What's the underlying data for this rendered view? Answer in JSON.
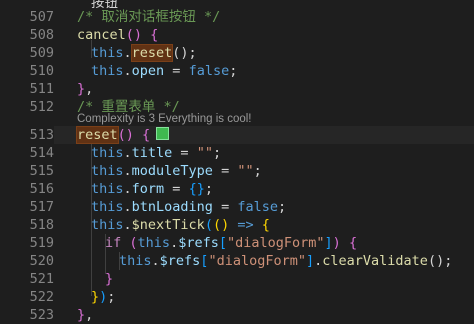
{
  "editor": {
    "codelens": "Complexity is 3 Everything is cool!",
    "lines": [
      {
        "num": "",
        "tokens": [
          {
            "t": "按钮",
            "c": "c-txt"
          }
        ]
      },
      {
        "num": "507",
        "tokens": [
          {
            "t": "/* 取消对话框按钮 */",
            "c": "c-comment"
          }
        ]
      },
      {
        "num": "508",
        "tokens": [
          {
            "t": "cancel",
            "c": "c-fn"
          },
          {
            "t": "() ",
            "c": "c-p2"
          },
          {
            "t": "{",
            "c": "c-p2"
          }
        ]
      },
      {
        "num": "509",
        "tokens": [
          {
            "t": "this",
            "c": "c-kw"
          },
          {
            "t": ".",
            "c": "c-txt"
          },
          {
            "t": "reset",
            "c": "c-fn hl"
          },
          {
            "t": "();",
            "c": "c-txt"
          }
        ]
      },
      {
        "num": "510",
        "tokens": [
          {
            "t": "this",
            "c": "c-kw"
          },
          {
            "t": ".",
            "c": "c-txt"
          },
          {
            "t": "open",
            "c": "c-var"
          },
          {
            "t": " = ",
            "c": "c-txt"
          },
          {
            "t": "false",
            "c": "c-kw"
          },
          {
            "t": ";",
            "c": "c-txt"
          }
        ]
      },
      {
        "num": "511",
        "tokens": [
          {
            "t": "}",
            "c": "c-p2"
          },
          {
            "t": ",",
            "c": "c-txt"
          }
        ]
      },
      {
        "num": "512",
        "tokens": [
          {
            "t": "/* 重置表单 */",
            "c": "c-comment"
          }
        ]
      },
      {
        "num": "513",
        "tokens": [
          {
            "t": "reset",
            "c": "c-fn hl"
          },
          {
            "t": "() ",
            "c": "c-p2"
          },
          {
            "t": "{",
            "c": "c-p2"
          }
        ]
      },
      {
        "num": "514",
        "tokens": [
          {
            "t": "this",
            "c": "c-kw"
          },
          {
            "t": ".",
            "c": "c-txt"
          },
          {
            "t": "title",
            "c": "c-var"
          },
          {
            "t": " = ",
            "c": "c-txt"
          },
          {
            "t": "\"\"",
            "c": "c-str"
          },
          {
            "t": ";",
            "c": "c-txt"
          }
        ]
      },
      {
        "num": "515",
        "tokens": [
          {
            "t": "this",
            "c": "c-kw"
          },
          {
            "t": ".",
            "c": "c-txt"
          },
          {
            "t": "moduleType",
            "c": "c-var"
          },
          {
            "t": " = ",
            "c": "c-txt"
          },
          {
            "t": "\"\"",
            "c": "c-str"
          },
          {
            "t": ";",
            "c": "c-txt"
          }
        ]
      },
      {
        "num": "516",
        "tokens": [
          {
            "t": "this",
            "c": "c-kw"
          },
          {
            "t": ".",
            "c": "c-txt"
          },
          {
            "t": "form",
            "c": "c-var"
          },
          {
            "t": " = ",
            "c": "c-txt"
          },
          {
            "t": "{}",
            "c": "c-p3"
          },
          {
            "t": ";",
            "c": "c-txt"
          }
        ]
      },
      {
        "num": "517",
        "tokens": [
          {
            "t": "this",
            "c": "c-kw"
          },
          {
            "t": ".",
            "c": "c-txt"
          },
          {
            "t": "btnLoading",
            "c": "c-var"
          },
          {
            "t": " = ",
            "c": "c-txt"
          },
          {
            "t": "false",
            "c": "c-kw"
          },
          {
            "t": ";",
            "c": "c-txt"
          }
        ]
      },
      {
        "num": "518",
        "tokens": [
          {
            "t": "this",
            "c": "c-kw"
          },
          {
            "t": ".",
            "c": "c-txt"
          },
          {
            "t": "$nextTick",
            "c": "c-fn"
          },
          {
            "t": "(",
            "c": "c-p3"
          },
          {
            "t": "()",
            "c": "c-p1"
          },
          {
            "t": " => ",
            "c": "c-kw"
          },
          {
            "t": "{",
            "c": "c-p1"
          }
        ]
      },
      {
        "num": "519",
        "tokens": [
          {
            "t": "if",
            "c": "c-ctrl"
          },
          {
            "t": " ",
            "c": "c-txt"
          },
          {
            "t": "(",
            "c": "c-p2"
          },
          {
            "t": "this",
            "c": "c-kw"
          },
          {
            "t": ".",
            "c": "c-txt"
          },
          {
            "t": "$refs",
            "c": "c-var"
          },
          {
            "t": "[",
            "c": "c-p3"
          },
          {
            "t": "\"dialogForm\"",
            "c": "c-str"
          },
          {
            "t": "]",
            "c": "c-p3"
          },
          {
            "t": ")",
            "c": "c-p2"
          },
          {
            "t": " ",
            "c": "c-txt"
          },
          {
            "t": "{",
            "c": "c-p2"
          }
        ]
      },
      {
        "num": "520",
        "tokens": [
          {
            "t": "this",
            "c": "c-kw"
          },
          {
            "t": ".",
            "c": "c-txt"
          },
          {
            "t": "$refs",
            "c": "c-var"
          },
          {
            "t": "[",
            "c": "c-p3"
          },
          {
            "t": "\"dialogForm\"",
            "c": "c-str"
          },
          {
            "t": "]",
            "c": "c-p3"
          },
          {
            "t": ".",
            "c": "c-txt"
          },
          {
            "t": "clearValidate",
            "c": "c-fn"
          },
          {
            "t": "();",
            "c": "c-txt"
          }
        ]
      },
      {
        "num": "521",
        "tokens": [
          {
            "t": "}",
            "c": "c-p2"
          }
        ]
      },
      {
        "num": "522",
        "tokens": [
          {
            "t": "}",
            "c": "c-p1"
          },
          {
            "t": ")",
            "c": "c-p3"
          },
          {
            "t": ";",
            "c": "c-txt"
          }
        ]
      },
      {
        "num": "523",
        "tokens": [
          {
            "t": "}",
            "c": "c-p2"
          },
          {
            "t": ",",
            "c": "c-txt"
          }
        ]
      }
    ]
  }
}
